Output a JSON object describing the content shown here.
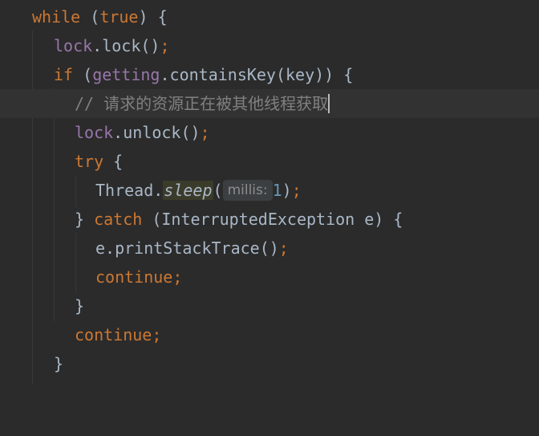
{
  "lines": {
    "l1": {
      "kw_while": "while",
      "p1": " (",
      "kw_true": "true",
      "p2": ") {"
    },
    "l2": {
      "field": "lock",
      "rest": ".lock()",
      "semi": ";"
    },
    "l3": {
      "kw_if": "if",
      "p1": " (",
      "field": "getting",
      "rest": ".containsKey(key)) {"
    },
    "l4": {
      "comment": "// 请求的资源正在被其他线程获取"
    },
    "l5": {
      "field": "lock",
      "rest": ".unlock()",
      "semi": ";"
    },
    "l6": {
      "kw_try": "try",
      "rest": " {"
    },
    "l7": {
      "cls": "Thread.",
      "method": "sleep",
      "p1": "(",
      "hint": "millis:",
      "num": "1",
      "p2": ")",
      "semi": ";"
    },
    "l8": {
      "p1": "} ",
      "kw_catch": "catch",
      "rest": " (InterruptedException e) {"
    },
    "l9": {
      "text": "e.printStackTrace()",
      "semi": ";"
    },
    "l10": {
      "kw": "continue",
      "semi": ";"
    },
    "l11": {
      "text": "}"
    },
    "l12": {
      "kw": "continue",
      "semi": ";"
    },
    "l13": {
      "text": "}"
    }
  },
  "colors": {
    "background": "#2b2b2b",
    "keyword": "#cc7832",
    "field": "#9876aa",
    "comment": "#808080",
    "number": "#6897bb",
    "text": "#a9b7c6"
  }
}
